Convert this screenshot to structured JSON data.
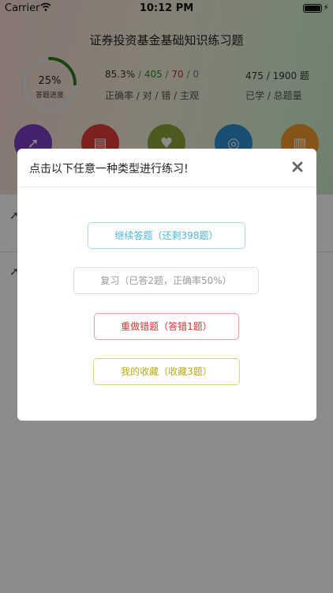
{
  "status_bar": {
    "carrier": "Carrier",
    "time": "10:12 PM"
  },
  "app": {
    "title": "证券投资基金基础知识练习题",
    "progress": {
      "percent_text": "25%",
      "label": "答题进度",
      "fraction": 0.25
    },
    "stats": {
      "accuracy": "85.3%",
      "correct": "405",
      "wrong": "70",
      "subjective": "0",
      "labels": "正确率 / 对 / 错 / 主观"
    },
    "totals": {
      "value": "475 / 1900 题",
      "labels": "已学 / 总题量"
    },
    "categories": [
      {
        "icon": "rocket-icon",
        "color": "#7b3fc4"
      },
      {
        "icon": "document-icon",
        "color": "#e23b3b"
      },
      {
        "icon": "heart-icon",
        "color": "#8aa23a"
      },
      {
        "icon": "wheel-icon",
        "color": "#2e8fd1"
      },
      {
        "icon": "chart-icon",
        "color": "#f29a2e"
      }
    ]
  },
  "modal": {
    "title": "点击以下任意一种类型进行练习!",
    "close_icon": "close-icon",
    "options": {
      "continue": "继续答题（还剩398题）",
      "review": "复习（已答2题，正确率50%）",
      "wrong": "重做错题（答错1题）",
      "favorite": "我的收藏（收藏3题）"
    }
  },
  "colors": {
    "continue": "#4ab6d8",
    "review": "#9a9a9a",
    "wrong": "#d83232",
    "favorite": "#b9a91c"
  }
}
